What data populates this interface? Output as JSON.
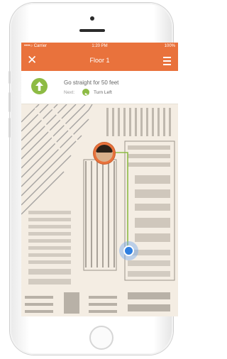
{
  "status_bar": {
    "carrier": "••••○ Carrier",
    "time": "1:20 PM",
    "battery": "100%"
  },
  "nav": {
    "title": "Floor 1",
    "close_icon": "close-icon",
    "menu_icon": "hamburger-menu-icon",
    "color": "#e9723c"
  },
  "direction": {
    "instruction": "Go straight for 50 feet",
    "next_label": "Next:",
    "next_action": "Turn Left",
    "turn_icon": "arrow-up-icon",
    "next_icon": "turn-left-icon",
    "accent": "#8dbb44"
  },
  "map": {
    "route_color": "#8dbb44",
    "location_color": "#2f7fe0"
  }
}
